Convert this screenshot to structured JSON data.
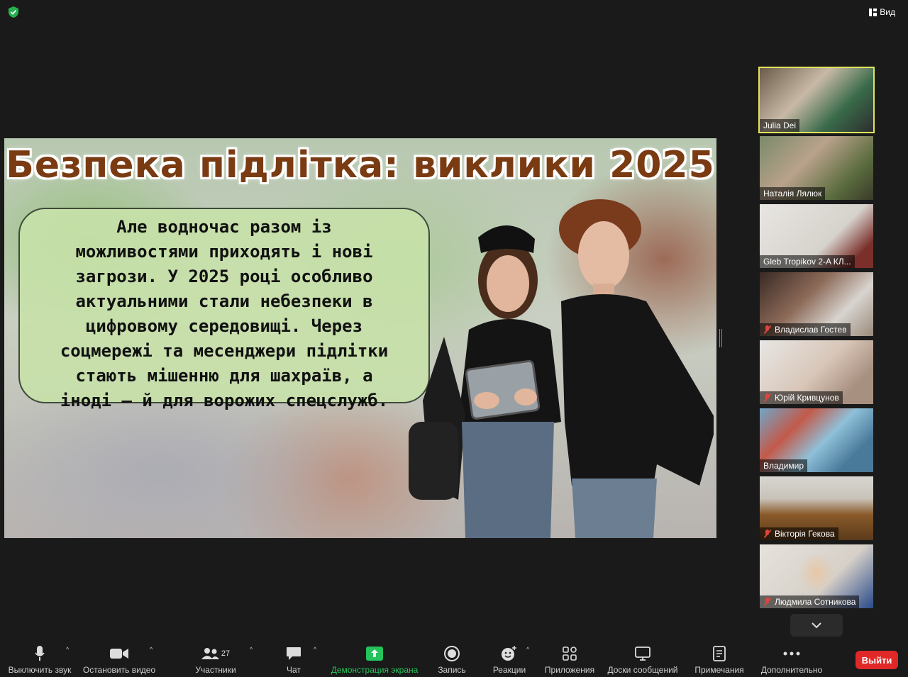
{
  "topbar": {
    "view_label": "Вид"
  },
  "slide": {
    "title": "Безпека підлітка: виклики 2025",
    "lines": [
      "Але водночас разом із",
      "можливостями приходять і нові",
      "загрози. У 2025 році особливо",
      "актуальними стали небезпеки в",
      "цифровому середовищі. Через",
      "соцмережі та месенджери підлітки",
      "стають мішенню для шахраїв, а",
      "іноді – й для ворожих спецслужб."
    ]
  },
  "participants": [
    {
      "name": "Julia Dei",
      "muted": false,
      "active": true
    },
    {
      "name": "Наталія Лялюк",
      "muted": false,
      "active": false
    },
    {
      "name": "Gleb Tropikov  2-A   КЛ...",
      "muted": false,
      "active": false
    },
    {
      "name": "Владислав Гостев",
      "muted": true,
      "active": false
    },
    {
      "name": "Юрій Кривцунов",
      "muted": true,
      "active": false
    },
    {
      "name": "Владимир",
      "muted": false,
      "active": false
    },
    {
      "name": "Вікторія Гекова",
      "muted": true,
      "active": false
    },
    {
      "name": "Людмила Сотникова",
      "muted": true,
      "active": false
    }
  ],
  "toolbar": {
    "mute": "Выключить звук",
    "video": "Остановить видео",
    "participants": "Участники",
    "participants_count": "27",
    "chat": "Чат",
    "share": "Демонстрация экрана",
    "record": "Запись",
    "reactions": "Реакции",
    "apps": "Приложения",
    "whiteboards": "Доски сообщений",
    "notes": "Примечания",
    "more": "Дополнительно",
    "leave": "Выйти"
  },
  "colors": {
    "accent_share": "#24c35b",
    "leave": "#e02828",
    "active_border": "#e1e35a",
    "title": "#7a3b12"
  }
}
